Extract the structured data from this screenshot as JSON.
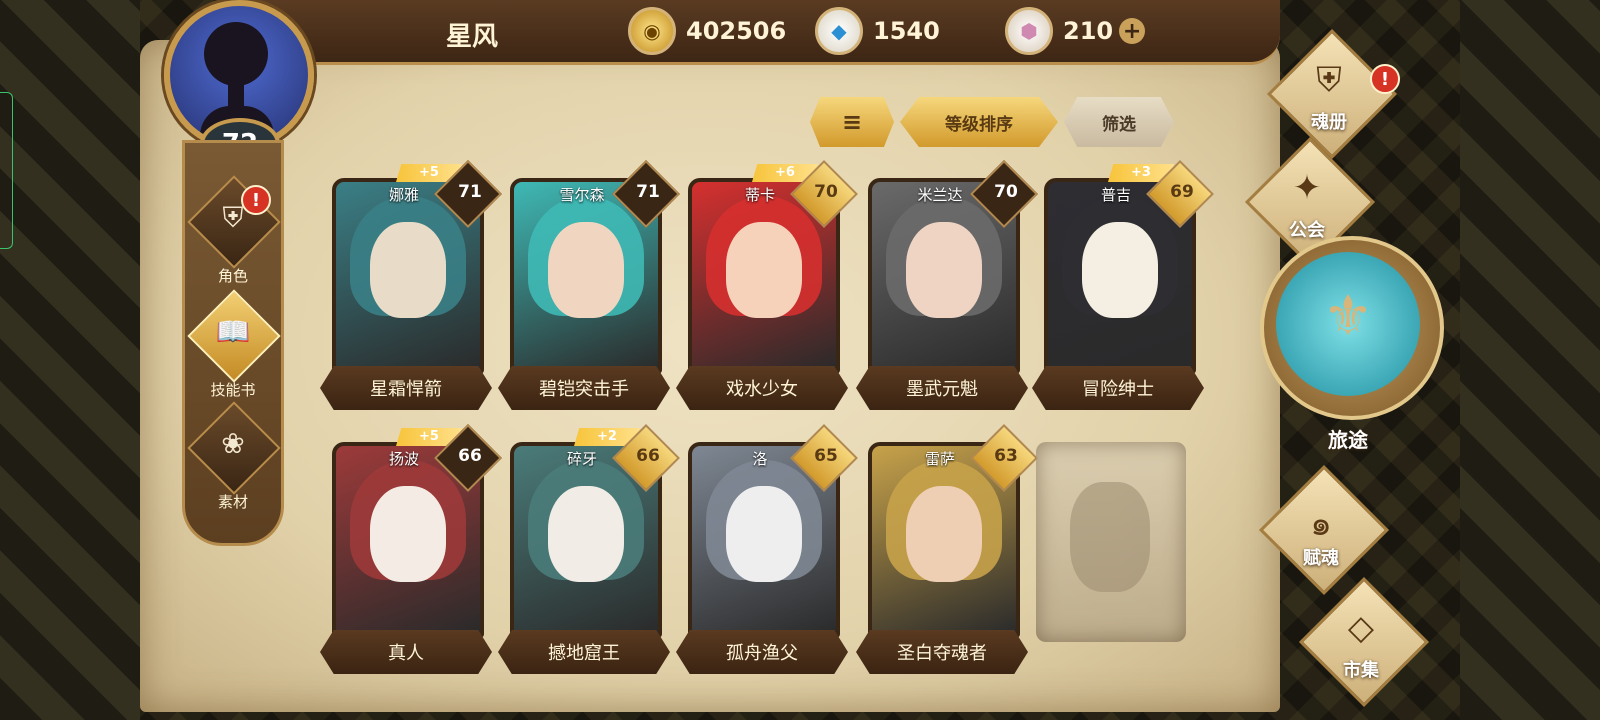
{
  "player": {
    "name": "星风",
    "level": "72"
  },
  "resources": {
    "gold": {
      "value": "402506",
      "icon": "gold-coin-icon"
    },
    "crystal": {
      "value": "1540",
      "icon": "blue-crystal-icon"
    },
    "gem": {
      "value": "210",
      "icon": "pink-gem-icon",
      "add": "+"
    }
  },
  "left_nav": [
    {
      "label": "角色",
      "icon": "helmet-icon",
      "alert": "!"
    },
    {
      "label": "技能书",
      "icon": "book-icon"
    },
    {
      "label": "素材",
      "icon": "mask-icon"
    }
  ],
  "toolbar": {
    "sort_icon": "≡",
    "sort_by_level": "等级排序",
    "filter": "筛选"
  },
  "cards": [
    {
      "name": "娜雅",
      "title": "星霜悍箭",
      "level": "71",
      "bonus": "+5",
      "colors": [
        "#e8dcc8",
        "#3a7f86"
      ]
    },
    {
      "name": "雪尔森",
      "title": "碧铠突击手",
      "level": "71",
      "bonus": "",
      "colors": [
        "#f0d6c0",
        "#3fb9b5"
      ]
    },
    {
      "name": "蒂卡",
      "title": "戏水少女",
      "level": "70",
      "bonus": "+6",
      "colors": [
        "#f7d2bb",
        "#d5302f"
      ]
    },
    {
      "name": "米兰达",
      "title": "墨武元魁",
      "level": "70",
      "bonus": "",
      "colors": [
        "#efd4c4",
        "#6a6a6a"
      ]
    },
    {
      "name": "普吉",
      "title": "冒险绅士",
      "level": "69",
      "bonus": "+3",
      "colors": [
        "#f4efe2",
        "#2e2d33"
      ]
    },
    {
      "name": "扬波",
      "title": "真人",
      "level": "66",
      "bonus": "+5",
      "colors": [
        "#f4ece4",
        "#9d3a3a"
      ]
    },
    {
      "name": "碎牙",
      "title": "撼地窟王",
      "level": "66",
      "bonus": "+2",
      "colors": [
        "#f1ede6",
        "#4a7c7a"
      ]
    },
    {
      "name": "洛",
      "title": "孤舟渔父",
      "level": "65",
      "bonus": "",
      "colors": [
        "#eeeeee",
        "#7e8793"
      ]
    },
    {
      "name": "雷萨",
      "title": "圣白夺魂者",
      "level": "63",
      "bonus": "",
      "colors": [
        "#efcfb3",
        "#c7a24a"
      ]
    }
  ],
  "right_nav": [
    {
      "label": "魂册",
      "icon": "helmet-icon",
      "alert": "!"
    },
    {
      "label": "公会",
      "icon": "wolf-emblem-icon"
    },
    {
      "label": "旅途",
      "icon": "compass-emblem-icon"
    },
    {
      "label": "赋魂",
      "icon": "swirl-icon"
    },
    {
      "label": "市集",
      "icon": "gem-shop-icon"
    }
  ]
}
